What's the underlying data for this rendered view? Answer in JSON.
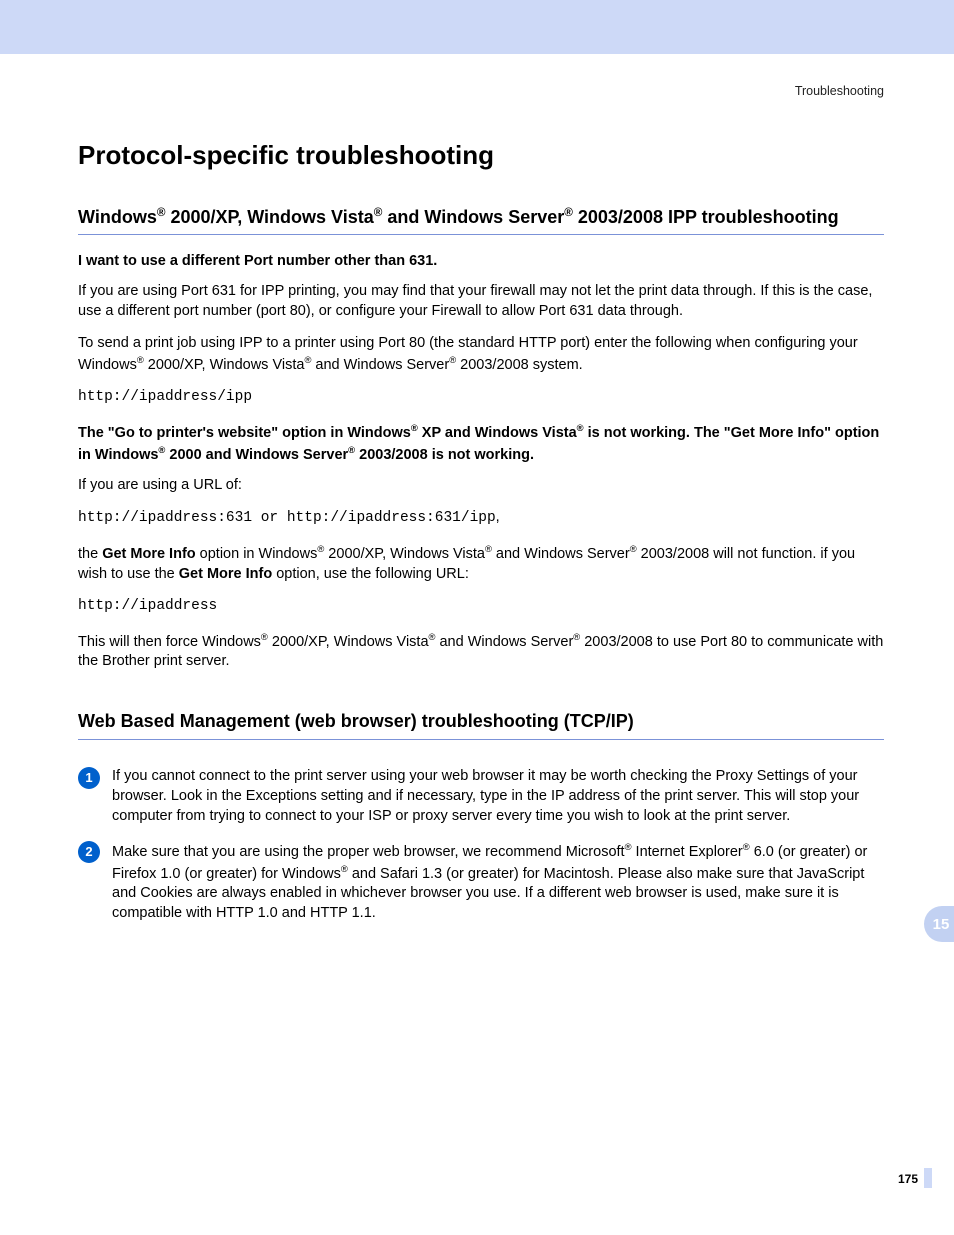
{
  "header": {
    "breadcrumb": "Troubleshooting"
  },
  "title": "Protocol-specific troubleshooting",
  "section1": {
    "heading_pre": "Windows",
    "heading_mid1": " 2000/XP, Windows Vista",
    "heading_mid2": " and Windows Server",
    "heading_post": " 2003/2008 IPP troubleshooting",
    "sub1": "I want to use a different Port number other than 631.",
    "p1": "If you are using Port 631 for IPP printing, you may find that your firewall may not let the print data through. If this is the case, use a different port number (port 80), or configure your Firewall to allow Port 631 data through.",
    "p2_pre": "To send a print job using IPP to a printer using Port 80 (the standard HTTP port) enter the following when configuring your Windows",
    "p2_mid1": " 2000/XP, Windows Vista",
    "p2_mid2": " and Windows Server",
    "p2_post": " 2003/2008 system.",
    "code1": "http://ipaddress/ipp",
    "sub2_a": "The \"Go to printer's website\" option in Windows",
    "sub2_b": " XP and Windows Vista",
    "sub2_c": " is not working. The \"Get More Info\" option in Windows",
    "sub2_d": " 2000 and Windows Server",
    "sub2_e": " 2003/2008 is not working.",
    "p3": "If you are using a URL of:",
    "code2": "http://ipaddress:631 or http://ipaddress:631/ipp",
    "code2_suffix": ",",
    "p4_a": "the ",
    "p4_b": "Get More Info",
    "p4_c": " option in Windows",
    "p4_d": " 2000/XP, Windows Vista",
    "p4_e": " and Windows Server",
    "p4_f": " 2003/2008 will not function. if you wish to use the ",
    "p4_g": "Get More Info",
    "p4_h": " option, use the following URL:",
    "code3": "http://ipaddress",
    "p5_a": "This will then force Windows",
    "p5_b": " 2000/XP, Windows Vista",
    "p5_c": " and Windows Server",
    "p5_d": " 2003/2008 to use Port 80 to communicate with the Brother print server."
  },
  "section2": {
    "heading": "Web Based Management (web browser) troubleshooting (TCP/IP)",
    "item1_num": "1",
    "item1": "If you cannot connect to the print server using your web browser it may be worth checking the Proxy Settings of your browser. Look in the Exceptions setting and if necessary, type in the IP address of the print server. This will stop your computer from trying to connect to your ISP or proxy server every time you wish to look at the print server.",
    "item2_num": "2",
    "item2_a": "Make sure that you are using the proper web browser, we recommend Microsoft",
    "item2_b": " Internet Explorer",
    "item2_c": " 6.0 (or greater) or Firefox 1.0 (or greater) for Windows",
    "item2_d": " and Safari 1.3 (or greater) for Macintosh. Please also make sure that JavaScript and Cookies are always enabled in whichever browser you use. If a different web browser is used, make sure it is compatible with HTTP 1.0 and HTTP 1.1."
  },
  "reg": "®",
  "tab": "15",
  "pagenum": "175"
}
